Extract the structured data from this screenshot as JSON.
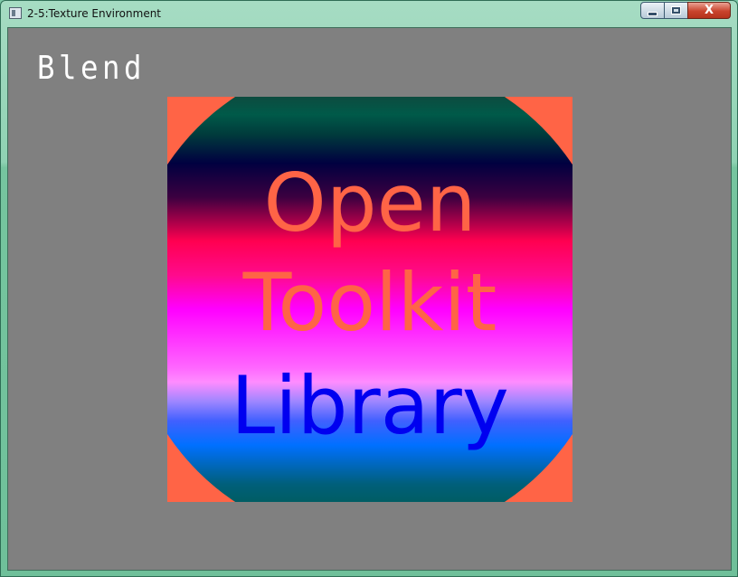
{
  "window": {
    "title": "2-5:Texture Environment",
    "minimize_glyph": "minimize-icon",
    "maximize_glyph": "maximize-icon",
    "close_label": "X"
  },
  "viewport": {
    "mode_label": "Blend",
    "background_color": "#808080"
  },
  "texture": {
    "lines": [
      "Open",
      "Toolkit",
      "Library"
    ],
    "border_color": "#ff6446",
    "text_color_top": "#ff6446",
    "text_color_bottom": "#0000f0"
  }
}
